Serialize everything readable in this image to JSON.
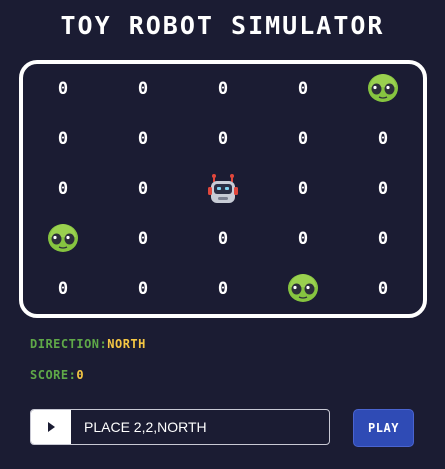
{
  "title": "TOY ROBOT SIMULATOR",
  "grid": {
    "rows": [
      [
        "0",
        "0",
        "0",
        "0",
        "alien"
      ],
      [
        "0",
        "0",
        "0",
        "0",
        "0"
      ],
      [
        "0",
        "0",
        "robot",
        "0",
        "0"
      ],
      [
        "alien",
        "0",
        "0",
        "0",
        "0"
      ],
      [
        "0",
        "0",
        "0",
        "alien",
        "0"
      ]
    ]
  },
  "icons": {
    "alien": "alien-icon",
    "robot": "robot-icon",
    "play": "play-icon"
  },
  "status": {
    "direction_label": "DIRECTION:",
    "direction_value": "NORTH",
    "score_label": "SCORE:",
    "score_value": "0"
  },
  "command": {
    "value": "PLACE 2,2,NORTH"
  },
  "play_button": {
    "label": "PLAY"
  },
  "colors": {
    "background": "#1b1c33",
    "board_border": "#ffffff",
    "label_green": "#5fa848",
    "value_yellow": "#f5c743",
    "button_blue": "#2f4bb5"
  }
}
